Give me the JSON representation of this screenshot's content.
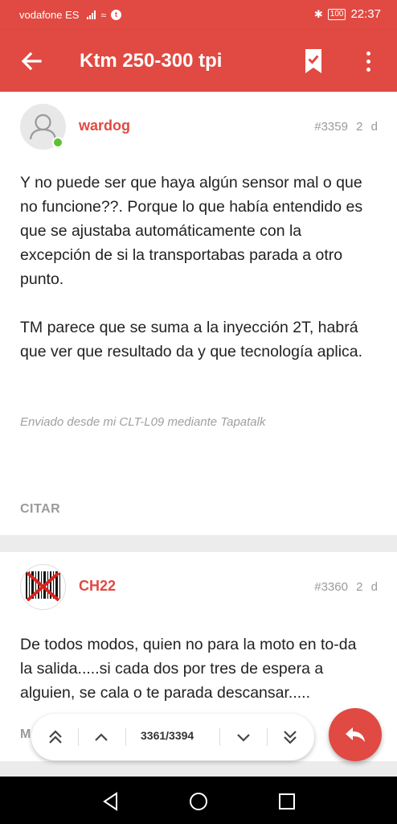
{
  "status_bar": {
    "carrier": "vodafone ES",
    "battery": "100",
    "time": "22:37"
  },
  "app_bar": {
    "title": "Ktm 250-300 tpi",
    "icons": [
      "back-arrow-icon",
      "bookmark-icon",
      "more-vert-icon"
    ]
  },
  "posts": [
    {
      "username": "wardog",
      "number": "#3359",
      "age": "2 d",
      "paragraphs": [
        "Y no puede ser que haya algún sensor mal o que no funcione??. Porque lo que había entendido es que se ajustaba automáticamente con la excepción de si la transportabas parada a otro punto.",
        "TM parece que se suma a la inyección 2T, habrá que ver que resultado da y que tecnología aplica."
      ],
      "signature": "Enviado desde mi CLT-L09 mediante Tapatalk",
      "quote_label": "CITAR"
    },
    {
      "username": "CH22",
      "number": "#3360",
      "age": "2 d",
      "paragraphs": [
        "De todos modos, quien no para la moto en to-da la salida.....si cada dos por tres de espera a alguien, se cala o te parada descansar....."
      ],
      "partial_label": "M"
    }
  ],
  "pager": {
    "position": "3361/3394"
  },
  "colors": {
    "accent": "#e04a42",
    "online": "#5cc22f",
    "muted": "#9a9a9a"
  }
}
